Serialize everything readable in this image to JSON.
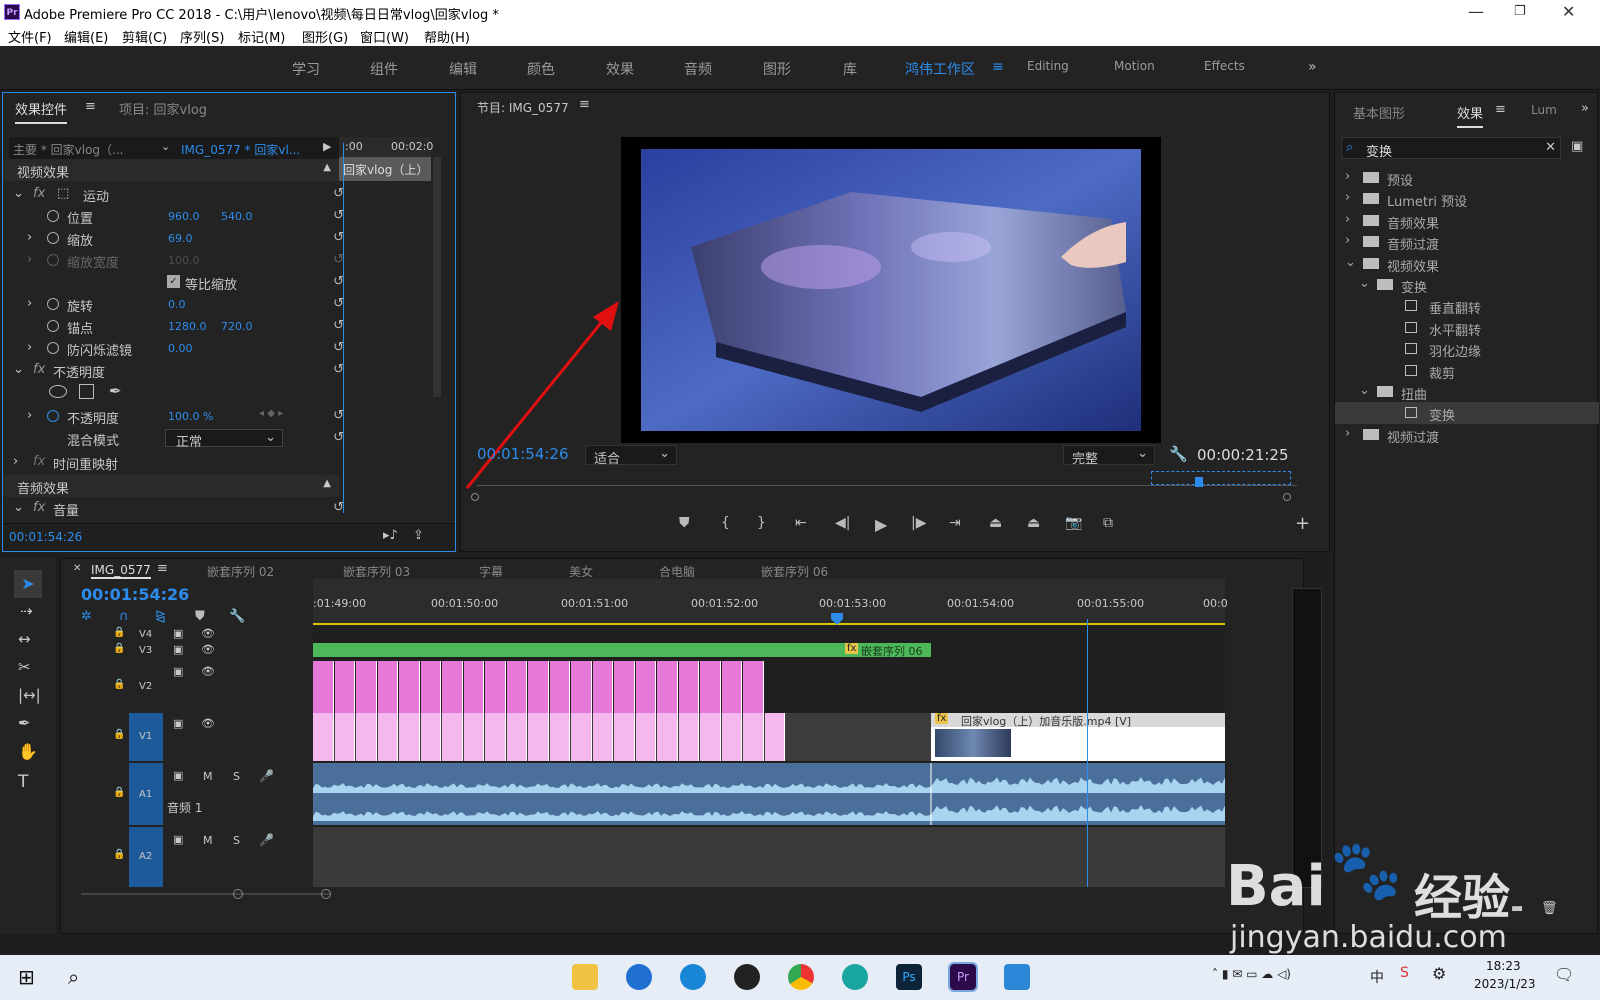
{
  "app": {
    "title": "Adobe Premiere Pro CC 2018 - C:\\用户\\lenovo\\视频\\每日日常vlog\\回家vlog *",
    "logo": "Pr"
  },
  "menu": [
    "文件(F)",
    "编辑(E)",
    "剪辑(C)",
    "序列(S)",
    "标记(M)",
    "图形(G)",
    "窗口(W)",
    "帮助(H)"
  ],
  "workspaces": [
    "学习",
    "组件",
    "编辑",
    "颜色",
    "效果",
    "音频",
    "图形",
    "库",
    "鸿伟工作区",
    "Editing",
    "Motion",
    "Effects"
  ],
  "workspace_active": "鸿伟工作区",
  "effect_controls": {
    "tab": "效果控件",
    "tab2": "项目: 回家vlog",
    "master": "主要 * 回家vlog（...",
    "clip": "IMG_0577 * 回家vl...",
    "ruler_start": ":00",
    "ruler_end": "00:02:0",
    "clip_bar": "回家vlog（上）",
    "video_effects": "视频效果",
    "motion": "运动",
    "position": "位置",
    "position_x": "960.0",
    "position_y": "540.0",
    "scale": "缩放",
    "scale_v": "69.0",
    "scale_width": "缩放宽度",
    "scale_width_v": "100.0",
    "uniform_scale": "等比缩放",
    "rotation": "旋转",
    "rotation_v": "0.0",
    "anchor": "锚点",
    "anchor_x": "1280.0",
    "anchor_y": "720.0",
    "flicker": "防闪烁滤镜",
    "flicker_v": "0.00",
    "opacity_group": "不透明度",
    "opacity": "不透明度",
    "opacity_v": "100.0 %",
    "blend": "混合模式",
    "blend_v": "正常",
    "time_remap": "时间重映射",
    "audio_effects": "音频效果",
    "volume": "音量",
    "timecode": "00:01:54:26"
  },
  "program": {
    "title": "节目: IMG_0577",
    "timecode": "00:01:54:26",
    "fit": "适合",
    "quality": "完整",
    "duration": "00:00:21:25"
  },
  "effects_panel": {
    "tab1": "基本图形",
    "tab2": "效果",
    "tab3": "Lum",
    "search": "变换",
    "tree": [
      {
        "label": "预设",
        "lvl": 0,
        "arrow": ">"
      },
      {
        "label": "Lumetri 预设",
        "lvl": 0,
        "arrow": ">"
      },
      {
        "label": "音频效果",
        "lvl": 0,
        "arrow": ">"
      },
      {
        "label": "音频过渡",
        "lvl": 0,
        "arrow": ">"
      },
      {
        "label": "视频效果",
        "lvl": 0,
        "arrow": "v"
      },
      {
        "label": "变换",
        "lvl": 1,
        "arrow": "v"
      },
      {
        "label": "垂直翻转",
        "lvl": 2,
        "arrow": ""
      },
      {
        "label": "水平翻转",
        "lvl": 2,
        "arrow": ""
      },
      {
        "label": "羽化边缘",
        "lvl": 2,
        "arrow": ""
      },
      {
        "label": "裁剪",
        "lvl": 2,
        "arrow": ""
      },
      {
        "label": "扭曲",
        "lvl": 1,
        "arrow": "v"
      },
      {
        "label": "变换",
        "lvl": 2,
        "arrow": ""
      },
      {
        "label": "视频过渡",
        "lvl": 0,
        "arrow": ">"
      }
    ]
  },
  "timeline": {
    "tabs": [
      "IMG_0577",
      "嵌套序列 02",
      "嵌套序列 03",
      "字幕",
      "美女",
      "合电脑",
      "嵌套序列 06"
    ],
    "timecode": "00:01:54:26",
    "ruler": [
      ":01:49:00",
      "00:01:50:00",
      "00:01:51:00",
      "00:01:52:00",
      "00:01:53:00",
      "00:01:54:00",
      "00:01:55:00",
      "00:0"
    ],
    "tracks": [
      "V4",
      "V3",
      "V2",
      "V1",
      "A1",
      "A2"
    ],
    "audio1_name": "音频 1",
    "nest_clip": "嵌套序列 06",
    "v1_clip": "回家vlog（上）加音乐版.mp4 [V]",
    "m": "M",
    "s": "S"
  },
  "taskbar": {
    "time": "18:23",
    "date": "2023/1/23",
    "ime": "中"
  },
  "watermark": {
    "brand": "Bai",
    "brand2": "经验",
    "url": "jingyan.baidu.com"
  },
  "colors": {
    "accent": "#2d8ceb",
    "nest": "#4cb85a",
    "pink": "#e678d8",
    "pink_light": "#f5b8ee",
    "audio": "#a9d4f0"
  }
}
